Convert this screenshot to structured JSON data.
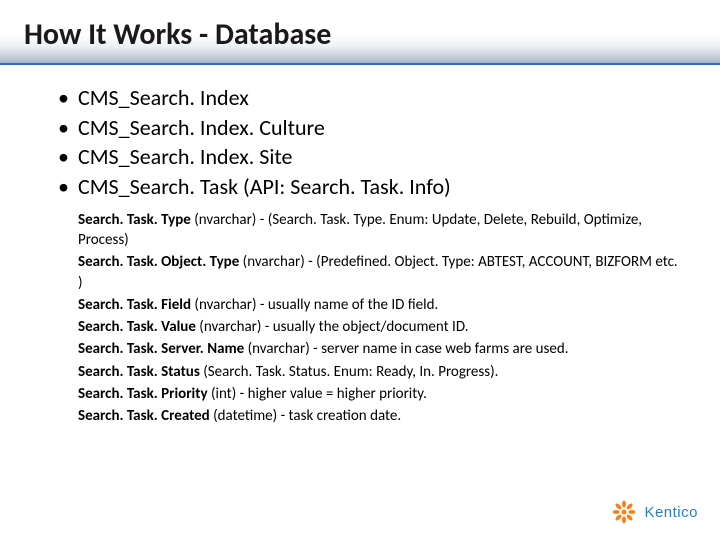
{
  "title": "How It Works - Database",
  "bullets": [
    "CMS_Search. Index",
    "CMS_Search. Index. Culture",
    "CMS_Search. Index. Site",
    "CMS_Search. Task (API: Search. Task. Info)"
  ],
  "details": [
    {
      "field": "Search. Task. Type",
      "rest": " (nvarchar) - (Search. Task. Type. Enum: Update, Delete, Rebuild, Optimize, Process)"
    },
    {
      "field": "Search. Task. Object. Type",
      "rest": " (nvarchar) - (Predefined. Object. Type: ABTEST, ACCOUNT, BIZFORM etc. )"
    },
    {
      "field": "Search. Task. Field",
      "rest": " (nvarchar) - usually name of the ID field."
    },
    {
      "field": "Search. Task. Value",
      "rest": " (nvarchar) - usually the object/document ID."
    },
    {
      "field": "Search. Task. Server. Name",
      "rest": " (nvarchar) - server name in case web farms are used."
    },
    {
      "field": "Search. Task. Status",
      "rest": " (Search. Task. Status. Enum: Ready, In. Progress)."
    },
    {
      "field": "Search. Task. Priority",
      "rest": " (int) - higher value = higher priority."
    },
    {
      "field": "Search. Task. Created",
      "rest": " (datetime) - task creation date."
    }
  ],
  "logo_text": "Kentico"
}
